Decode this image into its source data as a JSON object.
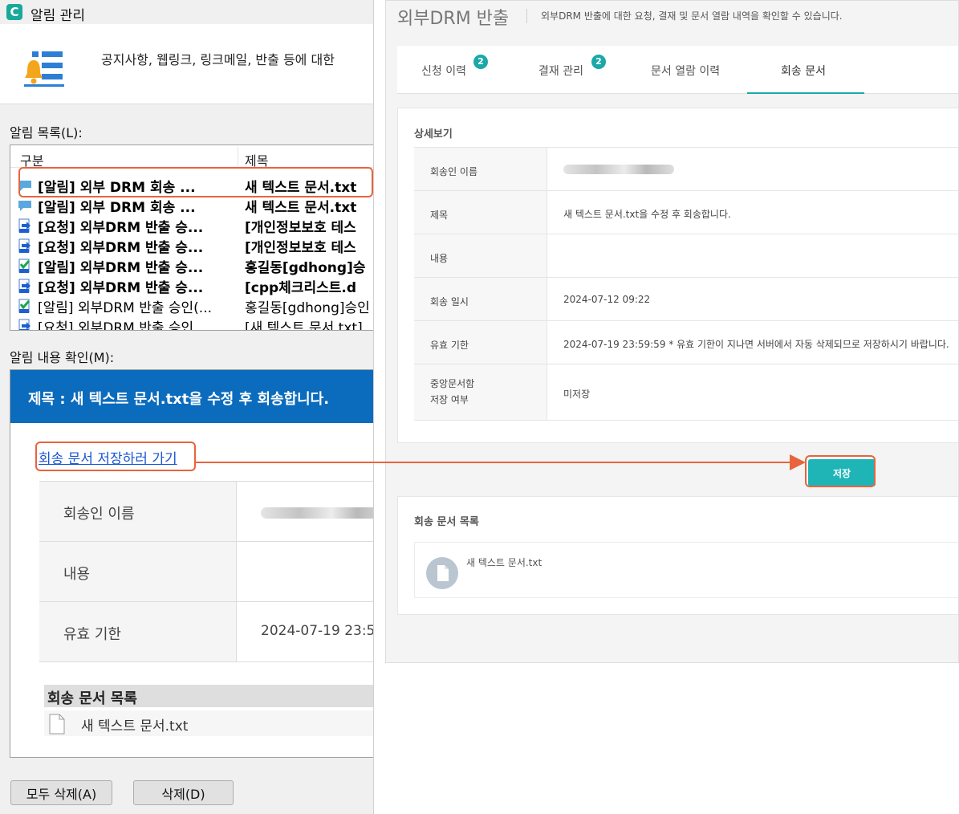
{
  "left_window": {
    "title": "알림 관리",
    "logo_letter": "C",
    "header_desc": "공지사항, 웹링크, 링크메일, 반출 등에 대한",
    "list_label": "알림 목록(L):",
    "columns": [
      "구분",
      "제목"
    ],
    "rows": [
      {
        "category": "[알림] 외부 DRM 회송 ...",
        "title": "새 텍스트 문서.txt",
        "bold": true
      },
      {
        "category": "[알림] 외부 DRM 회송 ...",
        "title": "새 텍스트 문서.txt",
        "bold": true
      },
      {
        "category": "[요청] 외부DRM 반출 승...",
        "title": "[개인정보보호 테스",
        "bold": true
      },
      {
        "category": "[요청] 외부DRM 반출 승...",
        "title": "[개인정보보호 테스",
        "bold": true
      },
      {
        "category": "[알림] 외부DRM 반출 승...",
        "title": "홍길동[gdhong]승",
        "bold": true
      },
      {
        "category": "[요청] 외부DRM 반출 승...",
        "title": "[cpp체크리스트.d",
        "bold": true
      },
      {
        "category": "[알림] 외부DRM 반출 승인(...",
        "title": "홍길동[gdhong]승인",
        "bold": false
      },
      {
        "category": "[요청] 외부DRM 반출 승인 ...",
        "title": "[새 텍스트 문서.txt]",
        "bold": false
      }
    ],
    "content_label": "알림 내용 확인(M):",
    "message": {
      "title": "제목 : 새 텍스트 문서.txt을 수정 후 회송합니다.",
      "link": "회송 문서 저장하러 가기",
      "fields": [
        {
          "label": "회송인 이름",
          "value": ""
        },
        {
          "label": "내용",
          "value": ""
        },
        {
          "label": "유효 기한",
          "value": "2024-07-19 23:5"
        }
      ],
      "files_header": "회송 문서 목록",
      "file_name": "새 텍스트 문서.txt"
    },
    "buttons": {
      "delete_all": "모두 삭제(A)",
      "delete": "삭제(D)"
    }
  },
  "right_panel": {
    "title": "외부DRM 반출",
    "description": "외부DRM 반출에 대한 요청, 결재 및 문서 열람 내역을 확인할 수 있습니다.",
    "tabs": [
      {
        "label": "신청 이력",
        "badge": "2"
      },
      {
        "label": "결재 관리",
        "badge": "2"
      },
      {
        "label": "문서 열람 이력",
        "badge": ""
      },
      {
        "label": "회송 문서",
        "badge": ""
      }
    ],
    "active_tab": "회송 문서",
    "detail": {
      "heading": "상세보기",
      "rows": [
        {
          "label": "회송인 이름",
          "value": ""
        },
        {
          "label": "제목",
          "value": "새 텍스트 문서.txt을 수정 후 회송합니다."
        },
        {
          "label": "내용",
          "value": ""
        },
        {
          "label": "회송 일시",
          "value": "2024-07-12 09:22"
        },
        {
          "label": "유효 기한",
          "value": "2024-07-19 23:59:59 * 유효 기한이 지나면 서버에서 자동 삭제되므로 저장하시기 바랍니다."
        },
        {
          "label": "중앙문서함\n저장 여부",
          "value": "미저장"
        }
      ]
    },
    "save_button": "저장",
    "files": {
      "heading": "회송 문서 목록",
      "file_name": "새 텍스트 문서.txt"
    }
  },
  "colors": {
    "accent_teal": "#1aa9a8",
    "highlight_orange": "#e8643c",
    "message_blue": "#0b6bbd"
  }
}
